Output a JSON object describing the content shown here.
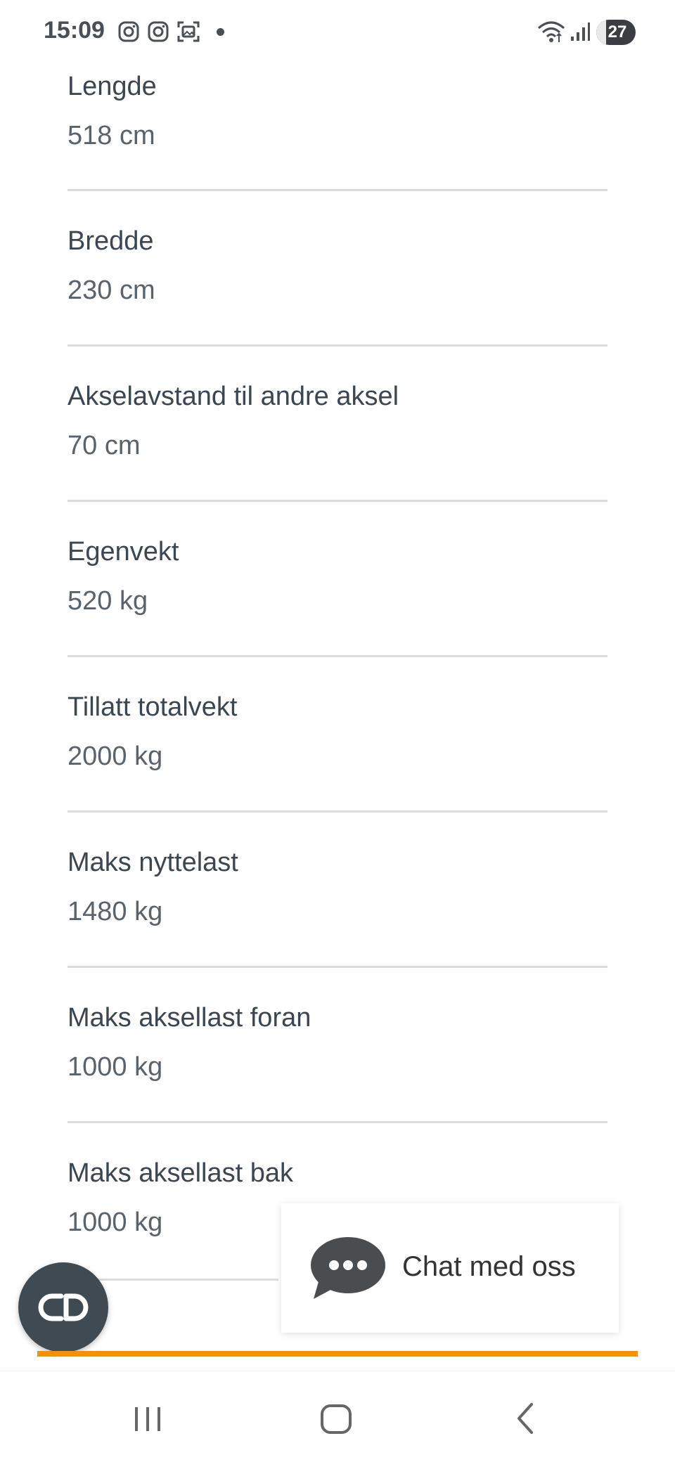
{
  "status_bar": {
    "time": "15:09",
    "battery_level": "27",
    "icons": [
      "instagram-icon",
      "instagram-icon",
      "screenshot-icon",
      "notification-dot",
      "wifi-icon",
      "signal-icon",
      "battery-icon"
    ]
  },
  "specs": [
    {
      "label": "Lengde",
      "value": "518 cm"
    },
    {
      "label": "Bredde",
      "value": "230 cm"
    },
    {
      "label": "Akselavstand til andre aksel",
      "value": "70 cm"
    },
    {
      "label": "Egenvekt",
      "value": "520 kg"
    },
    {
      "label": "Tillatt totalvekt",
      "value": "2000 kg"
    },
    {
      "label": "Maks nyttelast",
      "value": "1480 kg"
    },
    {
      "label": "Maks aksellast foran",
      "value": "1000 kg"
    },
    {
      "label": "Maks aksellast bak",
      "value": "1000 kg"
    }
  ],
  "chat": {
    "label": "Chat med oss",
    "icon": "chat-bubble-icon"
  },
  "fab": {
    "icon": "link-icon"
  },
  "progress": {
    "percent": 100,
    "color": "#f39200"
  },
  "nav": {
    "icons": [
      "recent-apps-icon",
      "home-icon",
      "back-icon"
    ]
  },
  "colors": {
    "accent": "#f39200",
    "text": "#3c4650",
    "fab": "#3f4a52"
  }
}
